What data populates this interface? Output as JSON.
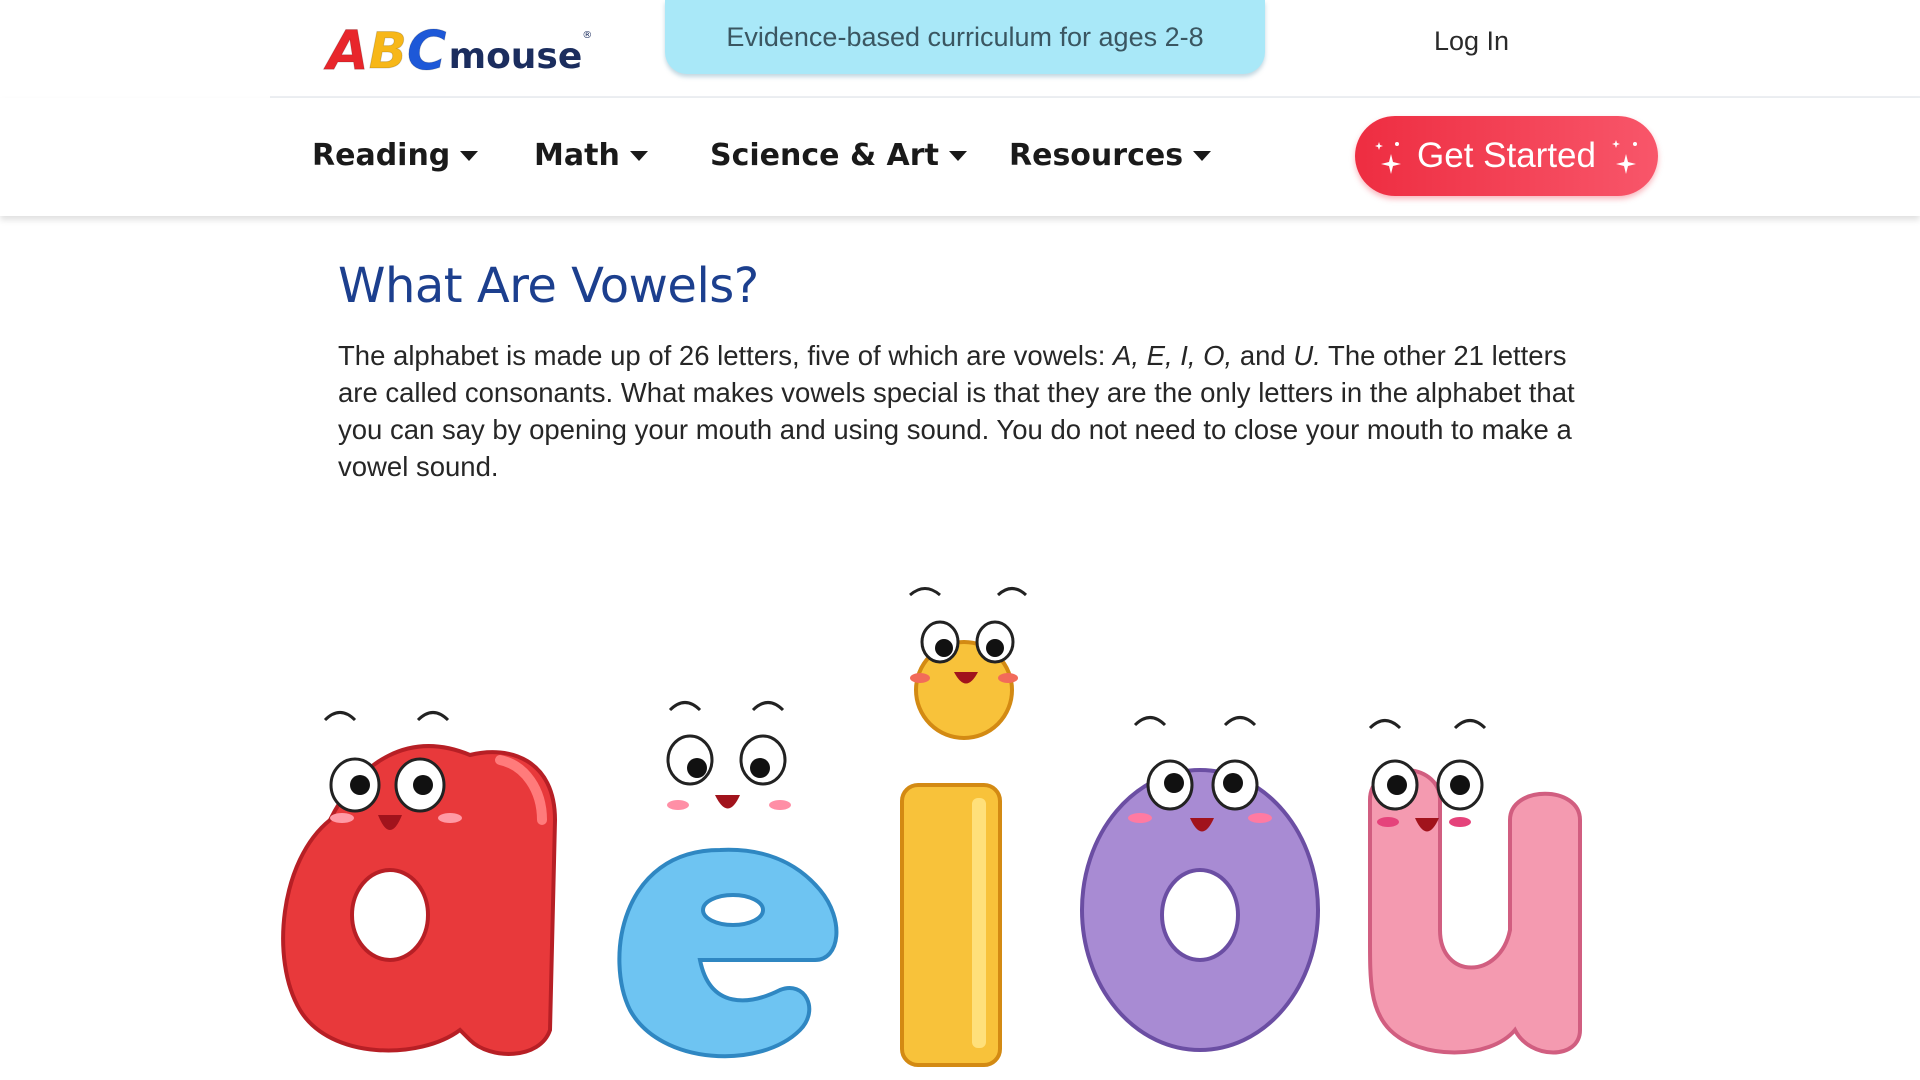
{
  "header": {
    "logo": {
      "letters": [
        "A",
        "B",
        "C"
      ],
      "word": "mouse",
      "registered_mark": "®"
    },
    "tagline": "Evidence-based curriculum for ages 2-8",
    "login_label": "Log In"
  },
  "nav": {
    "items": [
      {
        "label": "Reading"
      },
      {
        "label": "Math"
      },
      {
        "label": "Science & Art"
      },
      {
        "label": "Resources"
      }
    ],
    "cta_label": "Get Started"
  },
  "article": {
    "title": "What Are Vowels?",
    "paragraph": {
      "intro": "The alphabet is made up of 26 letters, five of which are vowels: ",
      "vowels_text": "A, E, I, O,",
      "and_word": " and ",
      "last_vowel": "U.",
      "rest": " The other 21 letters are called consonants. What makes vowels special is that they are the only letters in the alphabet that you can say by opening your mouth and using sound. You do not need to close your mouth to make a vowel sound."
    }
  },
  "illustration": {
    "letters": [
      {
        "char": "a",
        "color": "#e8393b"
      },
      {
        "char": "e",
        "color": "#6ec4f2"
      },
      {
        "char": "i",
        "color": "#f8c23a"
      },
      {
        "char": "o",
        "color": "#a88bd3"
      },
      {
        "char": "u",
        "color": "#f49ab0"
      }
    ]
  },
  "colors": {
    "accent_heading": "#1c3f8e",
    "cta": "#ee2d41",
    "tagline_bg": "#a9e8f8"
  }
}
